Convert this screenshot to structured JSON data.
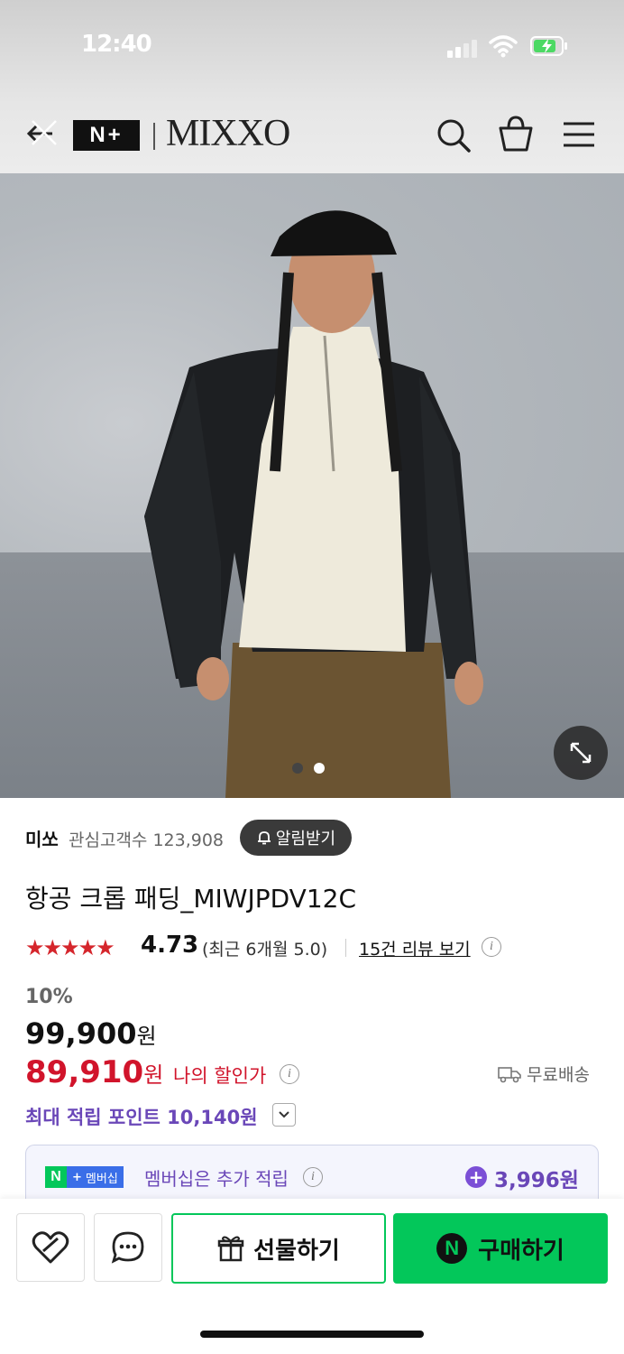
{
  "status": {
    "time": "12:40"
  },
  "header": {
    "back_label": "←",
    "nplus_label": "N+",
    "brand": "MIXXO"
  },
  "hero": {
    "page_count": 2,
    "current_page": 2
  },
  "seller": {
    "name": "미쏘",
    "watchers_label": "관심고객수 123,908",
    "alarm_label": "알림받기"
  },
  "product": {
    "title": "항공 크롭 패딩_MIWJPDV12C",
    "stars": "★★★★★",
    "rating": "4.73",
    "recent_rating": "(최근 6개월 5.0)",
    "review_link": "15건 리뷰 보기"
  },
  "price": {
    "discount_rate": "10%",
    "original": "99,900",
    "currency": "원",
    "sale": "89,910",
    "my_discount_label": "나의 할인가",
    "shipping_label": "무료배송",
    "points_label": "최대 적립 포인트 10,140원"
  },
  "membership": {
    "badge_n": "N",
    "badge_label": "멤버십",
    "text": "멤버십은 추가 적립",
    "points": "3,996원"
  },
  "bottom": {
    "gift_label": "선물하기",
    "buy_label": "구매하기",
    "buy_n": "N"
  },
  "colors": {
    "naver_green": "#03c75a",
    "sale_red": "#d1142b",
    "purple": "#6a47b8"
  }
}
